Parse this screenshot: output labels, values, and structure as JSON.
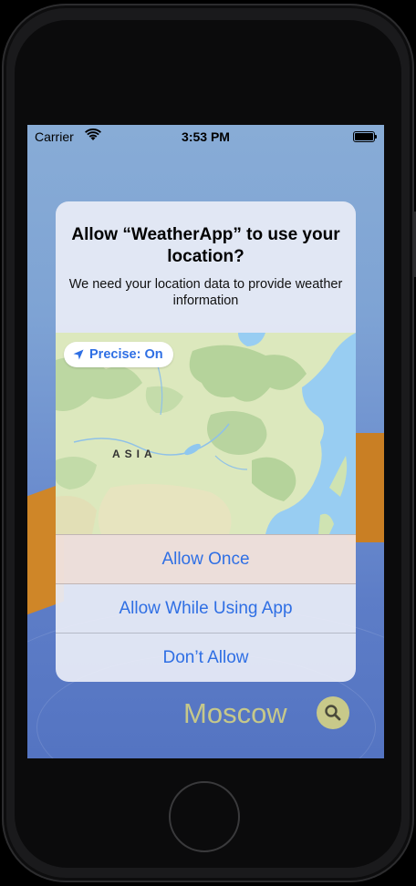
{
  "status_bar": {
    "carrier": "Carrier",
    "time": "3:53 PM"
  },
  "alert": {
    "title": "Allow “WeatherApp” to use your location?",
    "message": "We need your location data to provide weather information",
    "precise_label": "Precise: On",
    "map_region_label": "ASIA",
    "buttons": {
      "allow_once": "Allow Once",
      "allow_while_using": "Allow While Using App",
      "dont_allow": "Don’t Allow"
    }
  },
  "main": {
    "city": "Moscow"
  },
  "colors": {
    "accent_blue": "#2f6fe4",
    "city_text": "#c6c88a",
    "background_top": "#88acd6",
    "background_bottom": "#5474c2"
  },
  "icons": {
    "wifi": "wifi-icon",
    "battery": "battery-icon",
    "location_arrow": "location-arrow-icon",
    "search": "search-icon"
  }
}
